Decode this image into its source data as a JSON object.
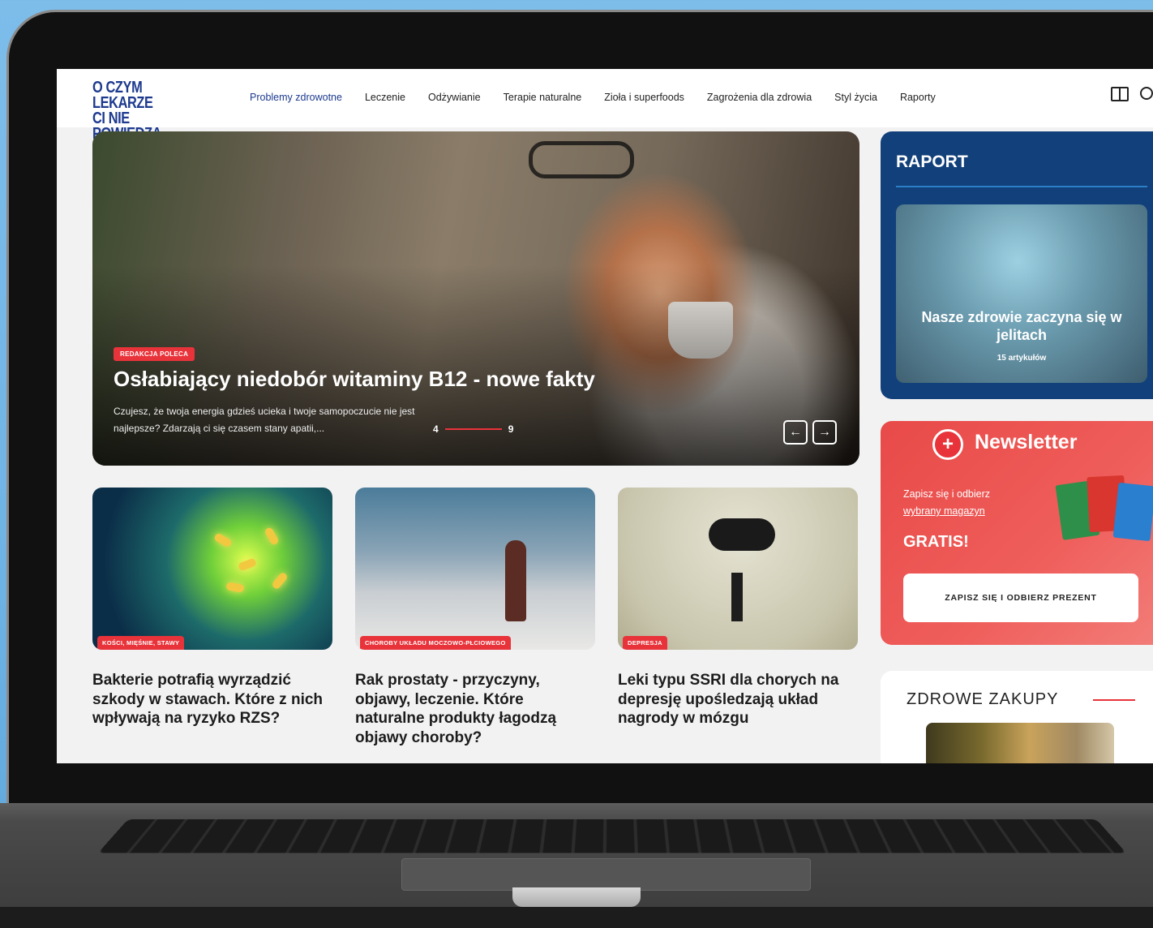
{
  "site": {
    "logo_line1": "O CZYM LEKARZE",
    "logo_line2": "CI NIE POWIEDZĄ"
  },
  "nav": {
    "items": [
      {
        "label": "Problemy zdrowotne",
        "active": true
      },
      {
        "label": "Leczenie"
      },
      {
        "label": "Odżywianie"
      },
      {
        "label": "Terapie naturalne"
      },
      {
        "label": "Zioła i superfoods"
      },
      {
        "label": "Zagrożenia dla zdrowia"
      },
      {
        "label": "Styl życia"
      },
      {
        "label": "Raporty"
      }
    ],
    "icons": [
      "book-icon",
      "search-icon"
    ]
  },
  "hero": {
    "badge": "REDAKCJA POLECA",
    "title": "Osłabiający niedobór witaminy B12 - nowe fakty",
    "description_line1": "Czujesz, że twoja energia gdzieś ucieka i twoje samopoczucie nie jest",
    "description_line2": "najlepsze? Zdarzają ci się czasem stany apatii,...",
    "pager_current": "4",
    "pager_total": "9",
    "prev_icon": "arrow-left-icon",
    "next_icon": "arrow-right-icon"
  },
  "cards": [
    {
      "badge": "KOŚCI, MIĘŚNIE, STAWY",
      "title": "Bakterie potrafią wyrządzić szkody w stawach. Które z nich wpływają na ryzyko RZS?"
    },
    {
      "badge": "CHOROBY UKŁADU MOCZOWO-PŁCIOWEGO",
      "title": "Rak prostaty - przyczyny, objawy, leczenie. Które naturalne produkty łagodzą objawy choroby?"
    },
    {
      "badge": "DEPRESJA",
      "title": "Leki typu SSRI dla chorych na depresję upośledzają układ nagrody w mózgu"
    }
  ],
  "raport": {
    "heading": "RAPORT",
    "title": "Nasze zdrowie zaczyna się w jelitach",
    "count": "15 artykułów"
  },
  "newsletter": {
    "title": "Newsletter",
    "text_line1": "Zapisz się i odbierz",
    "text_link": "wybrany magazyn",
    "gratis": "GRATIS!",
    "button": "ZAPISZ SIĘ I ODBIERZ PREZENT"
  },
  "shop": {
    "title": "ZDROWE ZAKUPY"
  },
  "colors": {
    "brand_blue": "#1d3a8f",
    "accent_red": "#e8333a",
    "raport_bg": "#12407a"
  }
}
